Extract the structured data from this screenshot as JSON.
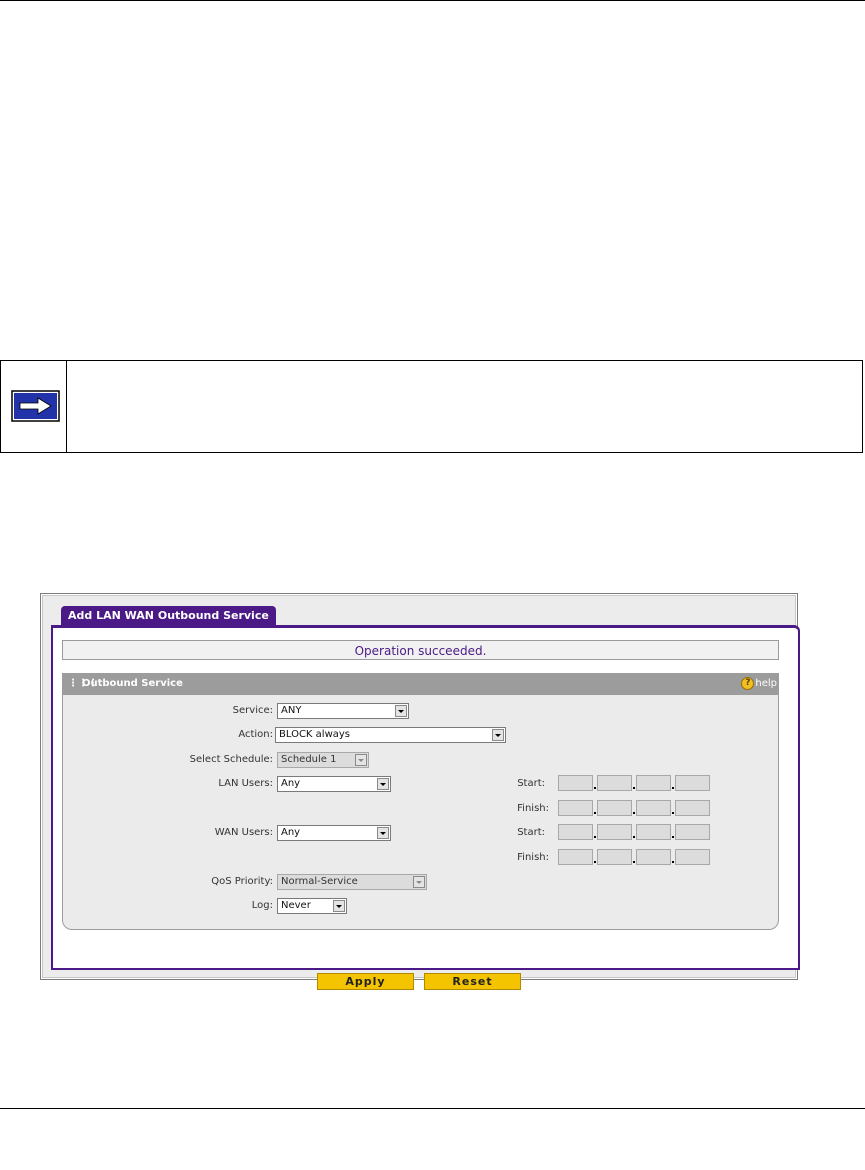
{
  "note": {
    "icon": "right-arrow-icon"
  },
  "screenshot": {
    "tab_label": "Add LAN WAN Outbound Service",
    "status_message": "Operation succeeded.",
    "section": {
      "title": "Outbound Service",
      "help_label": "help",
      "help_icon": "help-icon"
    },
    "fields": {
      "service": {
        "label": "Service:",
        "value": "ANY"
      },
      "action": {
        "label": "Action:",
        "value": "BLOCK always"
      },
      "schedule": {
        "label": "Select Schedule:",
        "value": "Schedule 1"
      },
      "lan_users": {
        "label": "LAN Users:",
        "value": "Any"
      },
      "wan_users": {
        "label": "WAN Users:",
        "value": "Any"
      },
      "qos": {
        "label": "QoS Priority:",
        "value": "Normal-Service"
      },
      "log": {
        "label": "Log:",
        "value": "Never"
      }
    },
    "ip_labels": {
      "start": "Start:",
      "finish": "Finish:"
    },
    "buttons": {
      "apply": "Apply",
      "reset": "Reset"
    }
  },
  "colors": {
    "accent": "#4b1a86",
    "button": "#f5c400",
    "section_header": "#9c9c9c",
    "note_arrow": "#2233aa"
  }
}
